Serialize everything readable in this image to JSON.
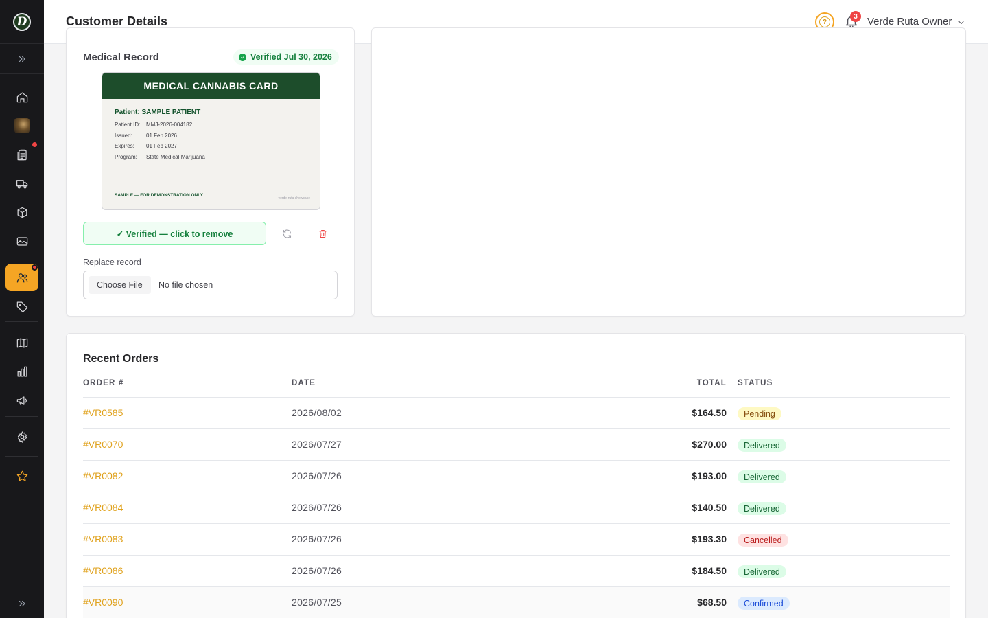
{
  "header": {
    "title": "Customer Details",
    "notifications_count": "3",
    "user_name": "Verde Ruta Owner",
    "help_glyph": "?"
  },
  "sidebar": {
    "logo_letter": "D",
    "items": [
      {
        "icon": "home-icon"
      },
      {
        "icon": "avatar"
      },
      {
        "icon": "clipboard-icon",
        "has_dot": true
      },
      {
        "icon": "truck-icon"
      },
      {
        "icon": "box-icon"
      },
      {
        "icon": "image-icon"
      },
      {
        "icon": "users-icon",
        "active": true,
        "has_dot": true
      },
      {
        "icon": "tag-icon"
      },
      {
        "icon": "map-icon"
      },
      {
        "icon": "bar-chart-icon"
      },
      {
        "icon": "megaphone-icon"
      },
      {
        "icon": "gear-icon"
      },
      {
        "icon": "star-icon"
      }
    ],
    "accent_color": "#f5a524"
  },
  "medical_record": {
    "title": "Medical Record",
    "verified_badge": "Verified Jul 30, 2026",
    "card": {
      "heading": "MEDICAL CANNABIS CARD",
      "patient": "Patient: SAMPLE PATIENT",
      "rows": [
        {
          "label": "Patient ID:",
          "value": "MMJ-2026-004182"
        },
        {
          "label": "Issued:",
          "value": "01 Feb 2026"
        },
        {
          "label": "Expires:",
          "value": "01 Feb 2027"
        },
        {
          "label": "Program:",
          "value": "State Medical Marijuana"
        }
      ],
      "footer": "SAMPLE — FOR DEMONSTRATION ONLY",
      "watermark": "verde-ruta showcase"
    },
    "verify_button": "✓ Verified — click to remove",
    "replace_label": "Replace record",
    "file_button": "Choose File",
    "file_status": "No file chosen"
  },
  "orders": {
    "title": "Recent Orders",
    "columns": {
      "order": "ORDER #",
      "date": "DATE",
      "total": "TOTAL",
      "status": "STATUS"
    },
    "rows": [
      {
        "order": "#VR0585",
        "date": "2026/08/02",
        "total": "$164.50",
        "status": "Pending"
      },
      {
        "order": "#VR0070",
        "date": "2026/07/27",
        "total": "$270.00",
        "status": "Delivered"
      },
      {
        "order": "#VR0082",
        "date": "2026/07/26",
        "total": "$193.00",
        "status": "Delivered"
      },
      {
        "order": "#VR0084",
        "date": "2026/07/26",
        "total": "$140.50",
        "status": "Delivered"
      },
      {
        "order": "#VR0083",
        "date": "2026/07/26",
        "total": "$193.30",
        "status": "Cancelled"
      },
      {
        "order": "#VR0086",
        "date": "2026/07/26",
        "total": "$184.50",
        "status": "Delivered"
      },
      {
        "order": "#VR0090",
        "date": "2026/07/25",
        "total": "$68.50",
        "status": "Confirmed"
      }
    ],
    "status_colors": {
      "Pending": "#fef9c3",
      "Delivered": "#dcfce7",
      "Cancelled": "#fee2e2",
      "Confirmed": "#dbeafe"
    }
  }
}
